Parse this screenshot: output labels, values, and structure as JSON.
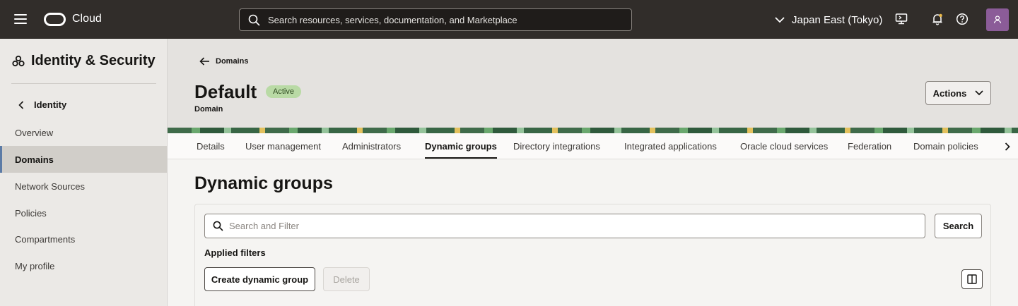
{
  "topbar": {
    "brand": "Cloud",
    "search_placeholder": "Search resources, services, documentation, and Marketplace",
    "region": "Japan East (Tokyo)"
  },
  "sidebar": {
    "title": "Identity & Security",
    "back_label": "Identity",
    "items": [
      {
        "label": "Overview"
      },
      {
        "label": "Domains"
      },
      {
        "label": "Network Sources"
      },
      {
        "label": "Policies"
      },
      {
        "label": "Compartments"
      },
      {
        "label": "My profile"
      }
    ],
    "active_index": 1
  },
  "header": {
    "breadcrumb": "Domains",
    "title": "Default",
    "status": "Active",
    "subtitle": "Domain",
    "actions_label": "Actions"
  },
  "tabs": [
    {
      "label": "Details"
    },
    {
      "label": "User management"
    },
    {
      "label": "Administrators"
    },
    {
      "label": "Dynamic groups"
    },
    {
      "label": "Directory integrations"
    },
    {
      "label": "Integrated applications"
    },
    {
      "label": "Oracle cloud services"
    },
    {
      "label": "Federation"
    },
    {
      "label": "Domain policies"
    }
  ],
  "active_tab_index": 3,
  "main": {
    "title": "Dynamic groups",
    "filter_placeholder": "Search and Filter",
    "search_label": "Search",
    "applied_filters_label": "Applied filters",
    "create_label": "Create dynamic group",
    "delete_label": "Delete"
  },
  "colors": {
    "topbar": "#312d2a",
    "status_badge": "#b9daa5",
    "nav_active_bar": "#5c7ba6",
    "avatar": "#8b5c98"
  }
}
